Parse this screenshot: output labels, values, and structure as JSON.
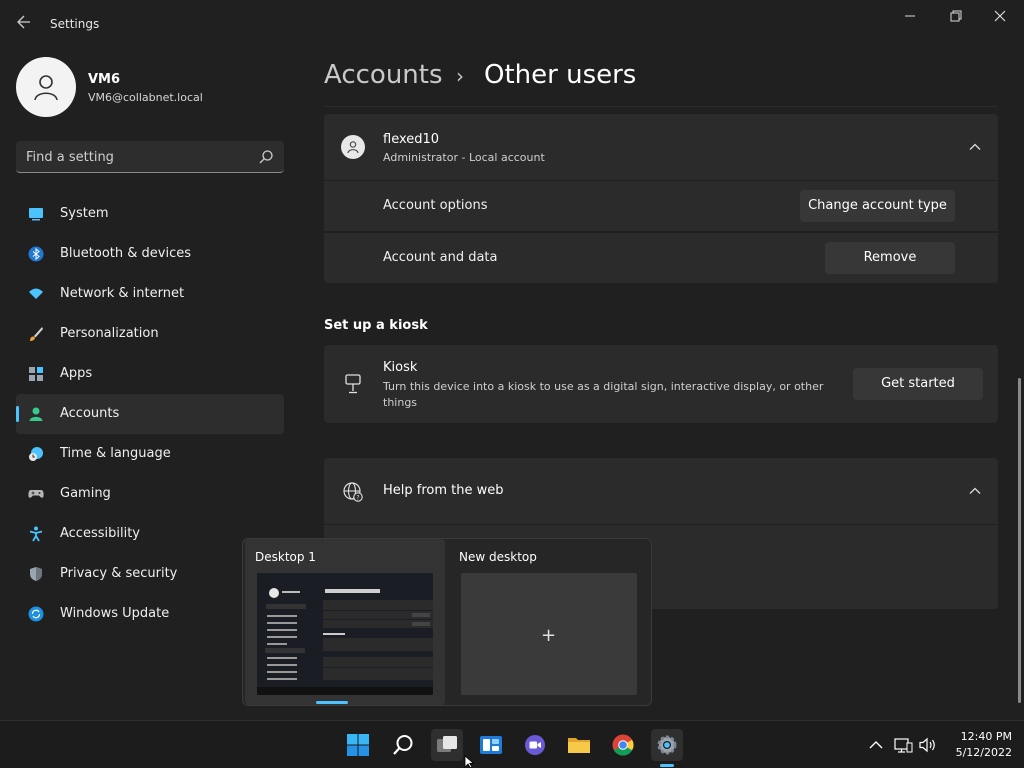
{
  "window": {
    "title": "Settings"
  },
  "profile": {
    "name": "VM6",
    "email": "VM6@collabnet.local"
  },
  "search": {
    "placeholder": "Find a setting"
  },
  "nav": {
    "items": [
      {
        "label": "System",
        "icon": "system-icon"
      },
      {
        "label": "Bluetooth & devices",
        "icon": "bluetooth-icon"
      },
      {
        "label": "Network & internet",
        "icon": "wifi-icon"
      },
      {
        "label": "Personalization",
        "icon": "brush-icon"
      },
      {
        "label": "Apps",
        "icon": "apps-icon"
      },
      {
        "label": "Accounts",
        "icon": "accounts-icon",
        "selected": true
      },
      {
        "label": "Time & language",
        "icon": "clock-globe-icon"
      },
      {
        "label": "Gaming",
        "icon": "gamepad-icon"
      },
      {
        "label": "Accessibility",
        "icon": "accessibility-icon"
      },
      {
        "label": "Privacy & security",
        "icon": "shield-icon"
      },
      {
        "label": "Windows Update",
        "icon": "update-icon"
      }
    ]
  },
  "breadcrumb": {
    "parent": "Accounts",
    "separator": "›",
    "current": "Other users"
  },
  "user": {
    "name": "flexed10",
    "subtitle": "Administrator - Local account",
    "rows": [
      {
        "label": "Account options",
        "button": "Change account type"
      },
      {
        "label": "Account and data",
        "button": "Remove"
      }
    ]
  },
  "kiosk": {
    "section_title": "Set up a kiosk",
    "title": "Kiosk",
    "description": "Turn this device into a kiosk to use as a digital sign, interactive display, or other things",
    "button": "Get started"
  },
  "help": {
    "label": "Help from the web"
  },
  "taskview": {
    "desktops": [
      {
        "label": "Desktop 1",
        "active": true
      },
      {
        "label": "New desktop",
        "action": "+"
      }
    ]
  },
  "taskbar": {
    "apps": [
      "start-icon",
      "search-icon",
      "task-view-icon",
      "widgets-icon",
      "teams-chat-icon",
      "file-explorer-icon",
      "chrome-icon",
      "settings-icon"
    ]
  },
  "clock": {
    "time": "12:40 PM",
    "date": "5/12/2022"
  },
  "colors": {
    "accent": "#4cc2ff",
    "background": "#202020",
    "card": "#2b2b2b"
  }
}
